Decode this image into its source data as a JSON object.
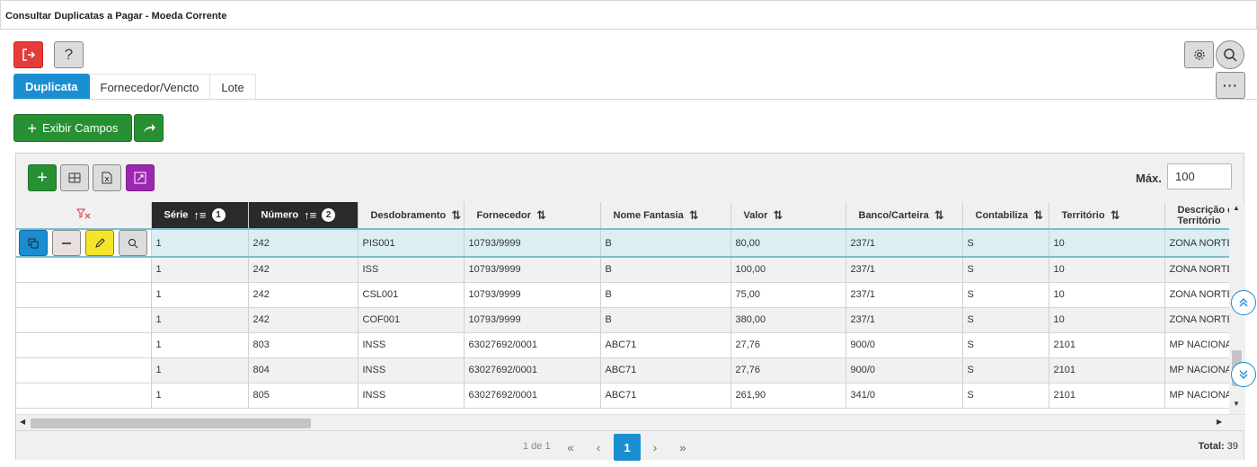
{
  "window": {
    "title": "Consultar Duplicatas a Pagar - Moeda Corrente"
  },
  "toolbar": {
    "help_label": "?",
    "more_label": "···"
  },
  "tabs": [
    {
      "label": "Duplicata",
      "active": true
    },
    {
      "label": "Fornecedor/Vencto",
      "active": false
    },
    {
      "label": "Lote",
      "active": false
    }
  ],
  "actions": {
    "exibir_campos_label": "Exibir Campos"
  },
  "grid_toolbar": {
    "max_label": "Máx.",
    "max_value": "100"
  },
  "table": {
    "columns": [
      {
        "label": "Série",
        "sort_order": "1"
      },
      {
        "label": "Número",
        "sort_order": "2"
      },
      {
        "label": "Desdobramento"
      },
      {
        "label": "Fornecedor"
      },
      {
        "label": "Nome Fantasia"
      },
      {
        "label": "Valor"
      },
      {
        "label": "Banco/Carteira"
      },
      {
        "label": "Contabiliza"
      },
      {
        "label": "Território"
      },
      {
        "label": "Descrição d Território"
      }
    ],
    "rows": [
      [
        "1",
        "242",
        "PIS001",
        "10793/9999",
        "B",
        "80,00",
        "237/1",
        "S",
        "10",
        "ZONA NORTE"
      ],
      [
        "1",
        "242",
        "ISS",
        "10793/9999",
        "B",
        "100,00",
        "237/1",
        "S",
        "10",
        "ZONA NORTE"
      ],
      [
        "1",
        "242",
        "CSL001",
        "10793/9999",
        "B",
        "75,00",
        "237/1",
        "S",
        "10",
        "ZONA NORTE"
      ],
      [
        "1",
        "242",
        "COF001",
        "10793/9999",
        "B",
        "380,00",
        "237/1",
        "S",
        "10",
        "ZONA NORTE"
      ],
      [
        "1",
        "803",
        "INSS",
        "63027692/0001",
        "ABC71",
        "27,76",
        "900/0",
        "S",
        "2101",
        "MP NACIONAL"
      ],
      [
        "1",
        "804",
        "INSS",
        "63027692/0001",
        "ABC71",
        "27,76",
        "900/0",
        "S",
        "2101",
        "MP NACIONAL"
      ],
      [
        "1",
        "805",
        "INSS",
        "63027692/0001",
        "ABC71",
        "261,90",
        "341/0",
        "S",
        "2101",
        "MP NACIONAL"
      ]
    ],
    "selected_row": 0
  },
  "pagination": {
    "info": "1 de 1",
    "current_page": "1",
    "total_label": "Total:",
    "total_value": "39"
  },
  "colors": {
    "accent": "#1b8ed1",
    "green": "#279033",
    "danger": "#e63b3b",
    "purple": "#9c27b0",
    "yellow": "#f3e52b"
  }
}
